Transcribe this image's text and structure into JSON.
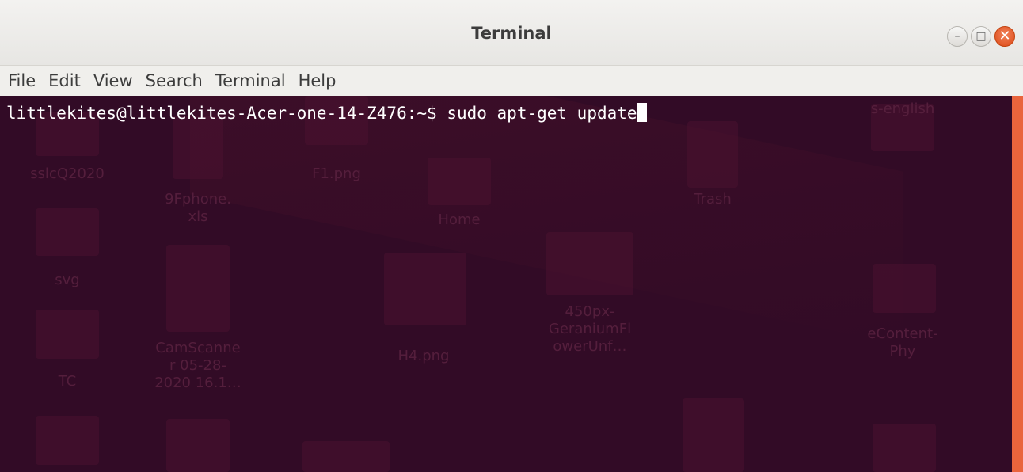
{
  "window": {
    "title": "Terminal",
    "buttons": {
      "minimize_glyph": "–",
      "maximize_glyph": "□",
      "close_glyph": "✕"
    }
  },
  "menu": {
    "items": [
      "File",
      "Edit",
      "View",
      "Search",
      "Terminal",
      "Help"
    ]
  },
  "terminal": {
    "prompt": "littlekites@littlekites-Acer-one-14-Z476:~$",
    "command": "sudo apt-get update",
    "background_color": "#320b26",
    "scrollbar_color": "#e9643c"
  },
  "desktop_background": {
    "icons": [
      {
        "label": "s-english",
        "icon": "folder-icon"
      },
      {
        "label": "sslcQ2020",
        "icon": "folder-icon"
      },
      {
        "label": "9Fphone.\nxls",
        "icon": "spreadsheet-file-icon"
      },
      {
        "label": "F1.png",
        "icon": "image-file-icon"
      },
      {
        "label": "Home",
        "icon": "home-folder-icon"
      },
      {
        "label": "Trash",
        "icon": "trash-icon"
      },
      {
        "label": "svg",
        "icon": "folder-icon"
      },
      {
        "label": "TC",
        "icon": "folder-icon"
      },
      {
        "label": "CamScanne\nr 05-28-\n2020 16.1…",
        "icon": "document-file-icon"
      },
      {
        "label": "H4.png",
        "icon": "image-file-icon"
      },
      {
        "label": "450px-\nGeraniumFl\nowerUnf…",
        "icon": "image-file-icon"
      },
      {
        "label": "eContent-\nPhy",
        "icon": "folder-icon"
      }
    ]
  }
}
